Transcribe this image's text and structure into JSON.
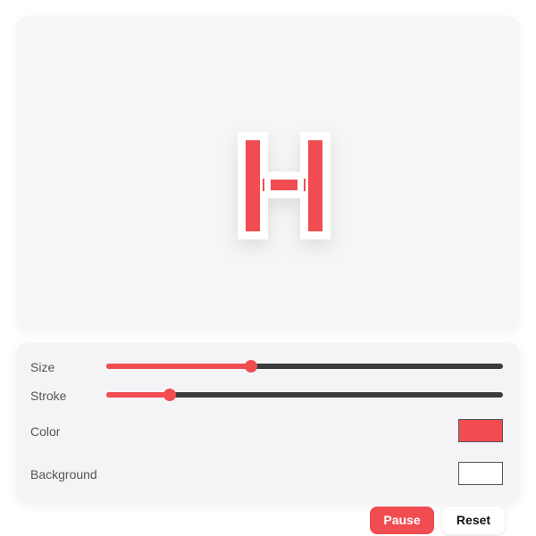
{
  "theme": {
    "accent": "#f04c52",
    "glyph_color": "#f04c52",
    "glyph_stroke_color": "#ffffff",
    "background_color": "#ffffff"
  },
  "preview": {
    "glyph_letter": "H"
  },
  "controls": {
    "size": {
      "label": "Size",
      "value": 0.365
    },
    "stroke": {
      "label": "Stroke",
      "value": 0.16
    },
    "color": {
      "label": "Color",
      "value": "#f04c52"
    },
    "background": {
      "label": "Background",
      "value": "#ffffff"
    }
  },
  "buttons": {
    "pause_label": "Pause",
    "reset_label": "Reset"
  }
}
